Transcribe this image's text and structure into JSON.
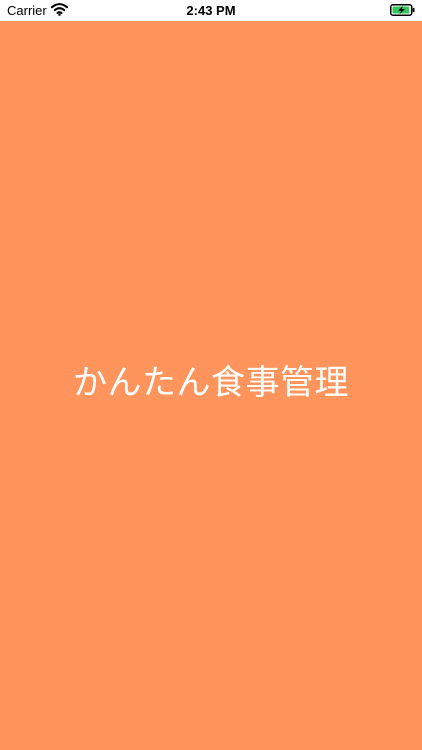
{
  "status_bar": {
    "carrier": "Carrier",
    "time": "2:43 PM",
    "wifi_icon": "wifi-icon",
    "battery_icon": "battery-charging-icon",
    "battery_color": "#34c759"
  },
  "splash": {
    "app_title": "かんたん食事管理",
    "background_color": "#ff955d",
    "text_color": "#ffffff"
  }
}
